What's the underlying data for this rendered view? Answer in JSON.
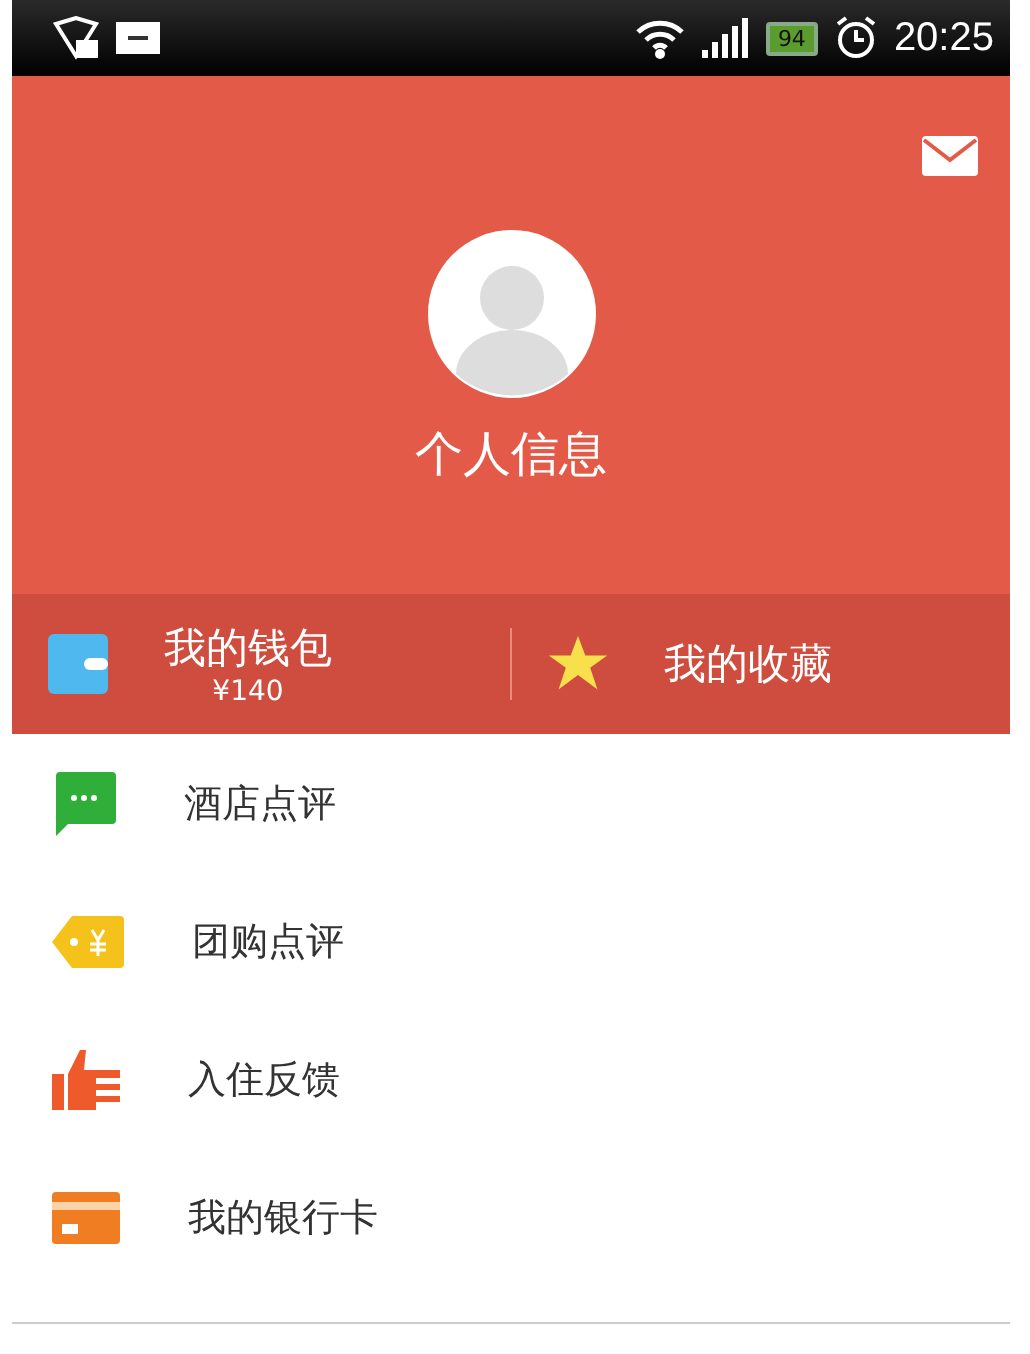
{
  "status_bar": {
    "battery": "94",
    "time": "20:25"
  },
  "profile": {
    "name": "个人信息"
  },
  "quick_links": [
    {
      "kind": "wallet",
      "label": "我的钱包",
      "sub": "¥140"
    },
    {
      "kind": "star",
      "label": "我的收藏"
    }
  ],
  "menu": [
    {
      "kind": "chat",
      "label": "酒店点评"
    },
    {
      "kind": "tag",
      "label": "团购点评"
    },
    {
      "kind": "thumb",
      "label": "入住反馈"
    },
    {
      "kind": "card",
      "label": "我的银行卡"
    }
  ]
}
